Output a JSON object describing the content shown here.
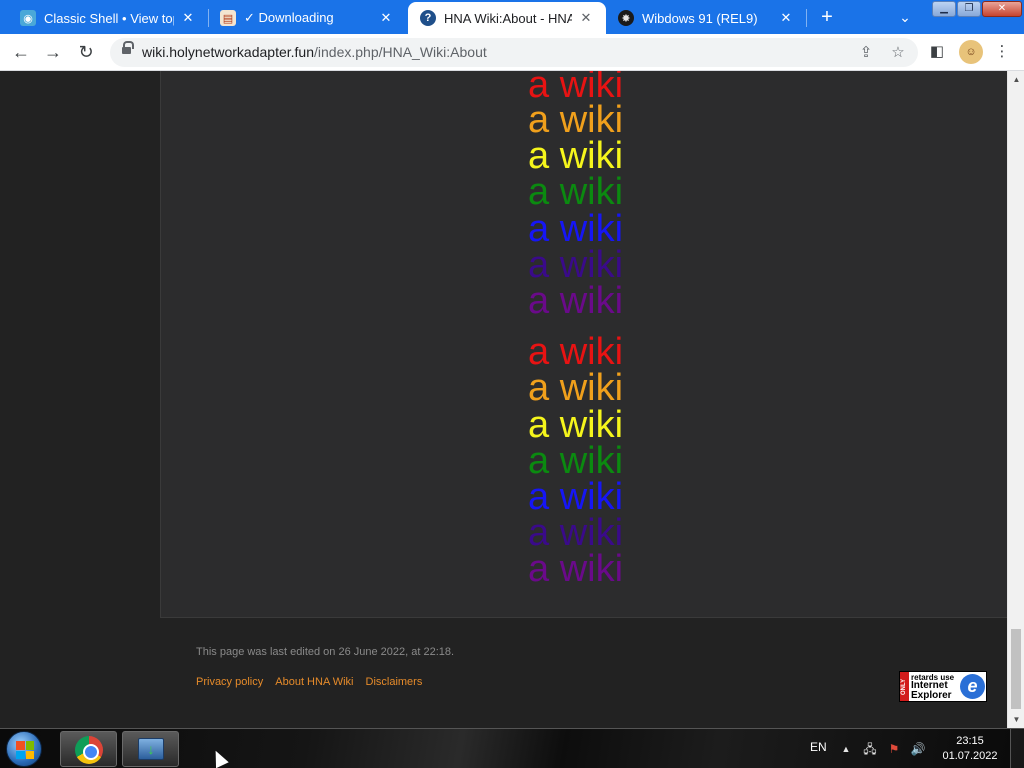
{
  "browser": {
    "tabs": [
      {
        "title": "Classic Shell • View topic",
        "favicon": "globe-icon",
        "active": false
      },
      {
        "title": "✓ Downloading",
        "favicon": "page-icon",
        "active": false
      },
      {
        "title": "HNA Wiki:About - HNA W",
        "favicon": "help-icon",
        "active": true
      },
      {
        "title": "Wibdows 91 (REL9)",
        "favicon": "wheel-icon",
        "active": false
      }
    ],
    "address": {
      "host": "wiki.holynetworkadapter.fun",
      "path": "/index.php/HNA_Wiki:About"
    }
  },
  "page": {
    "wiki_text": "a wiki",
    "colors": [
      "#e81313",
      "#f0a01c",
      "#f5f51c",
      "#0b8a10",
      "#1616f5",
      "#3a0a8a",
      "#6a0a8a"
    ],
    "footer": {
      "last_edited": "This page was last edited on 26 June 2022, at 22:18.",
      "links": [
        "Privacy policy",
        "About HNA Wiki",
        "Disclaimers"
      ]
    },
    "badge": {
      "strip": "ONLY",
      "line1": "retards use",
      "line2": "Internet Explorer",
      "logo": "e"
    }
  },
  "taskbar": {
    "language": "EN",
    "time": "23:15",
    "date": "01.07.2022"
  }
}
